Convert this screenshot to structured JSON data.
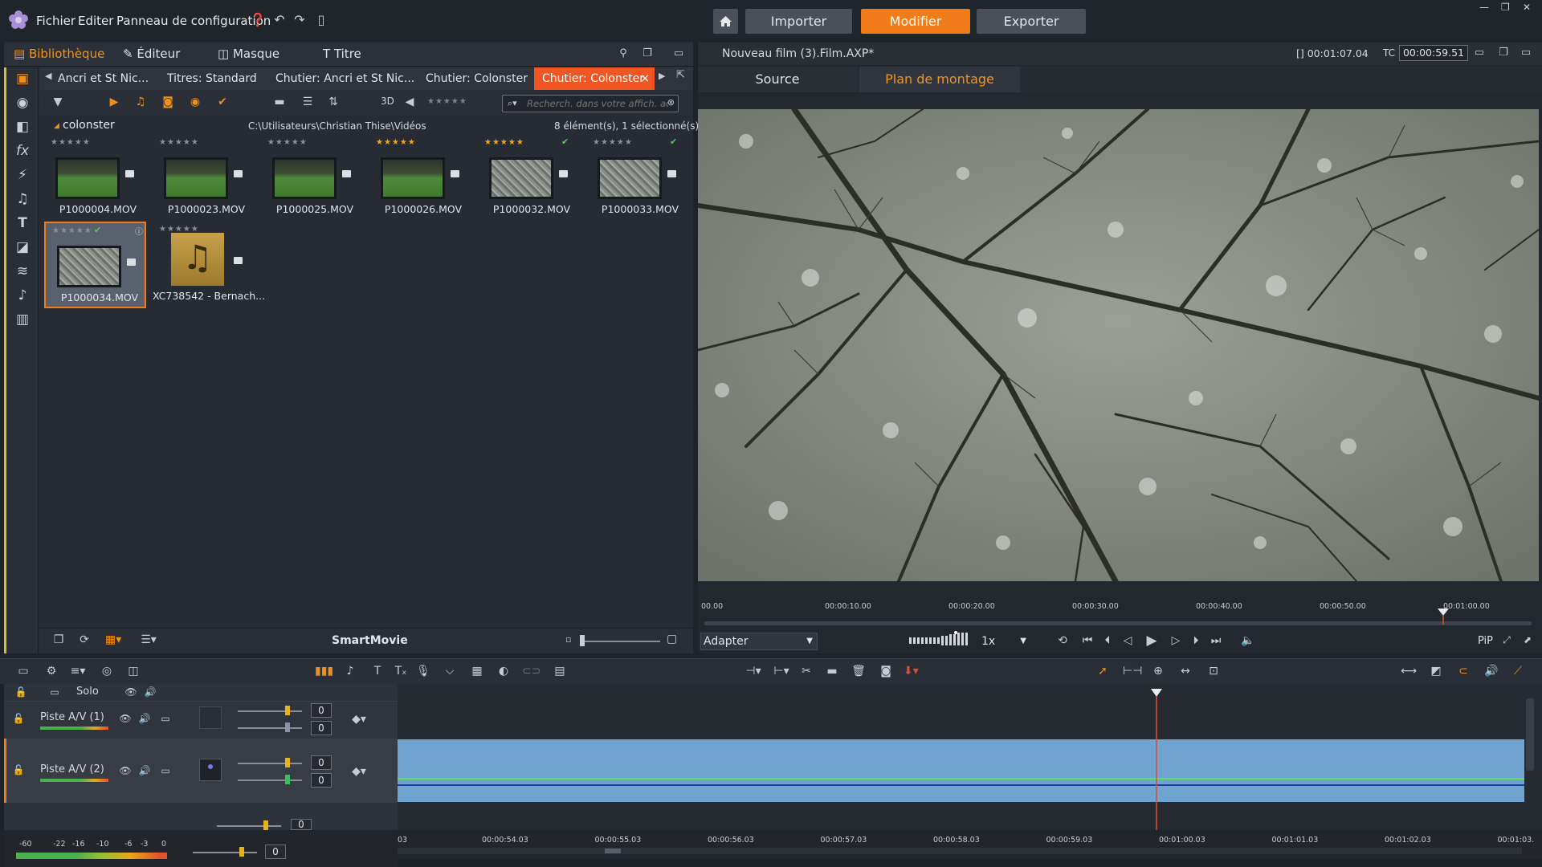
{
  "menu": {
    "file": "Fichier",
    "edit": "Editer",
    "control_panel": "Panneau de configuration"
  },
  "modes": {
    "import": "Importer",
    "edit": "Modifier",
    "export": "Exporter",
    "active": "edit"
  },
  "library_tabs": {
    "library": "Bibliothèque",
    "editor": "Éditeur",
    "mask": "Masque",
    "title": "Titre"
  },
  "bin_tabs": [
    {
      "label": "Ancri et St Nic..."
    },
    {
      "label": "Titres: Standard"
    },
    {
      "label": "Chutier: Ancri et St Nic..."
    },
    {
      "label": "Chutier: Colonster"
    },
    {
      "label": "Chutier: Colonster",
      "active": true
    }
  ],
  "toolbar": {
    "three_d": "3D",
    "search_placeholder": "Recherch. dans votre affich. actu"
  },
  "path": {
    "folder": "colonster",
    "location": "C:\\Utilisateurs\\Christian Thise\\Vidéos",
    "count": "8 élément(s), 1 sélectionné(s)"
  },
  "clips": [
    {
      "name": "P1000004.MOV",
      "stars": 0,
      "check": false,
      "kind": "green"
    },
    {
      "name": "P1000023.MOV",
      "stars": 0,
      "check": false,
      "kind": "green"
    },
    {
      "name": "P1000025.MOV",
      "stars": 0,
      "check": false,
      "kind": "green"
    },
    {
      "name": "P1000026.MOV",
      "stars": 5,
      "check": false,
      "kind": "green"
    },
    {
      "name": "P1000032.MOV",
      "stars": 5,
      "check": true,
      "kind": "gray"
    },
    {
      "name": "P1000033.MOV",
      "stars": 0,
      "check": true,
      "kind": "gray"
    },
    {
      "name": "P1000034.MOV",
      "stars": 0,
      "check": true,
      "kind": "gray",
      "selected": true
    },
    {
      "name": "XC738542 - Bernach...",
      "stars": 0,
      "check": false,
      "kind": "audio"
    }
  ],
  "library_bottom": {
    "smartmovie": "SmartMovie"
  },
  "player": {
    "title": "Nouveau film (3).Film.AXP*",
    "duration": "[] 00:01:07.04",
    "tc_label": "TC",
    "tc_value": "00:00:59.51",
    "tab_source": "Source",
    "tab_timeline": "Plan de montage",
    "ruler": [
      "00.00",
      "00:00:10.00",
      "00:00:20.00",
      "00:00:30.00",
      "00:00:40.00",
      "00:00:50.00",
      "00:01:00.00"
    ],
    "fit": "Adapter",
    "speed": "1x",
    "pip": "PiP"
  },
  "timeline": {
    "solo": "Solo",
    "track1": "Piste A/V (1)",
    "track2": "Piste A/V (2)",
    "t1_top": "0",
    "t1_bot": "0",
    "t2_top": "0",
    "t2_bot": "0",
    "t3": "0",
    "master": "0",
    "meter_labels": [
      "-60",
      "-22",
      "-16",
      "-10",
      "-6",
      "-3",
      "0"
    ],
    "ruler": [
      "03",
      "00:00:54.03",
      "00:00:55.03",
      "00:00:56.03",
      "00:00:57.03",
      "00:00:58.03",
      "00:00:59.03",
      "00:01:00.03",
      "00:01:01.03",
      "00:01:02.03",
      "00:01:03."
    ]
  },
  "colors": {
    "accent": "#f07d1a",
    "active_tab": "#f05623",
    "clip": "#6fa4d1"
  }
}
